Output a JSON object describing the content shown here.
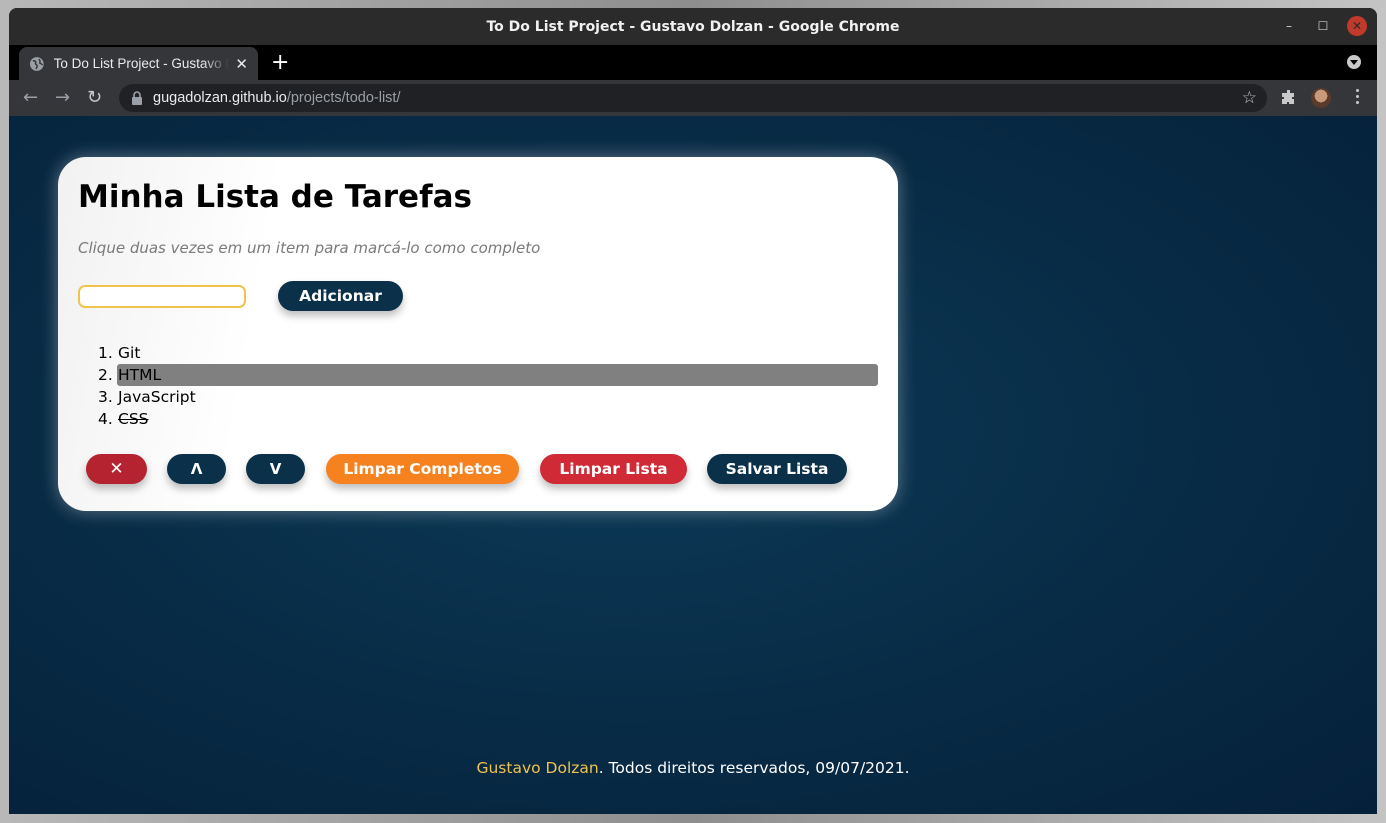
{
  "window": {
    "title": "To Do List Project - Gustavo Dolzan - Google Chrome"
  },
  "tabs": [
    {
      "label": "To Do List Project - Gustavo Dolzan"
    }
  ],
  "omnibox": {
    "domain": "gugadolzan.github.io",
    "path": "/projects/todo-list/"
  },
  "page": {
    "title": "Minha Lista de Tarefas",
    "instructions": "Clique duas vezes em um item para marcá-lo como completo",
    "input": {
      "value": "",
      "placeholder": ""
    },
    "add_button": "Adicionar",
    "tasks": [
      {
        "number": "1.",
        "text": "Git",
        "selected": false,
        "completed": false
      },
      {
        "number": "2.",
        "text": "HTML",
        "selected": true,
        "completed": false
      },
      {
        "number": "3.",
        "text": "JavaScript",
        "selected": false,
        "completed": false
      },
      {
        "number": "4.",
        "text": "CSS",
        "selected": false,
        "completed": true
      }
    ],
    "buttons": {
      "remove": "✕",
      "move_up": "Λ",
      "move_down": "V",
      "clear_completed": "Limpar Completos",
      "clear_list": "Limpar Lista",
      "save_list": "Salvar Lista"
    },
    "footer": {
      "author": "Gustavo Dolzan",
      "rest": ". Todos direitos reservados, 09/07/2021."
    }
  },
  "colors": {
    "navy": "#0b304a",
    "orange": "#f5821f",
    "red": "#cf2a35",
    "accent_yellow": "#f0c34f",
    "selected_gray": "#808080"
  }
}
